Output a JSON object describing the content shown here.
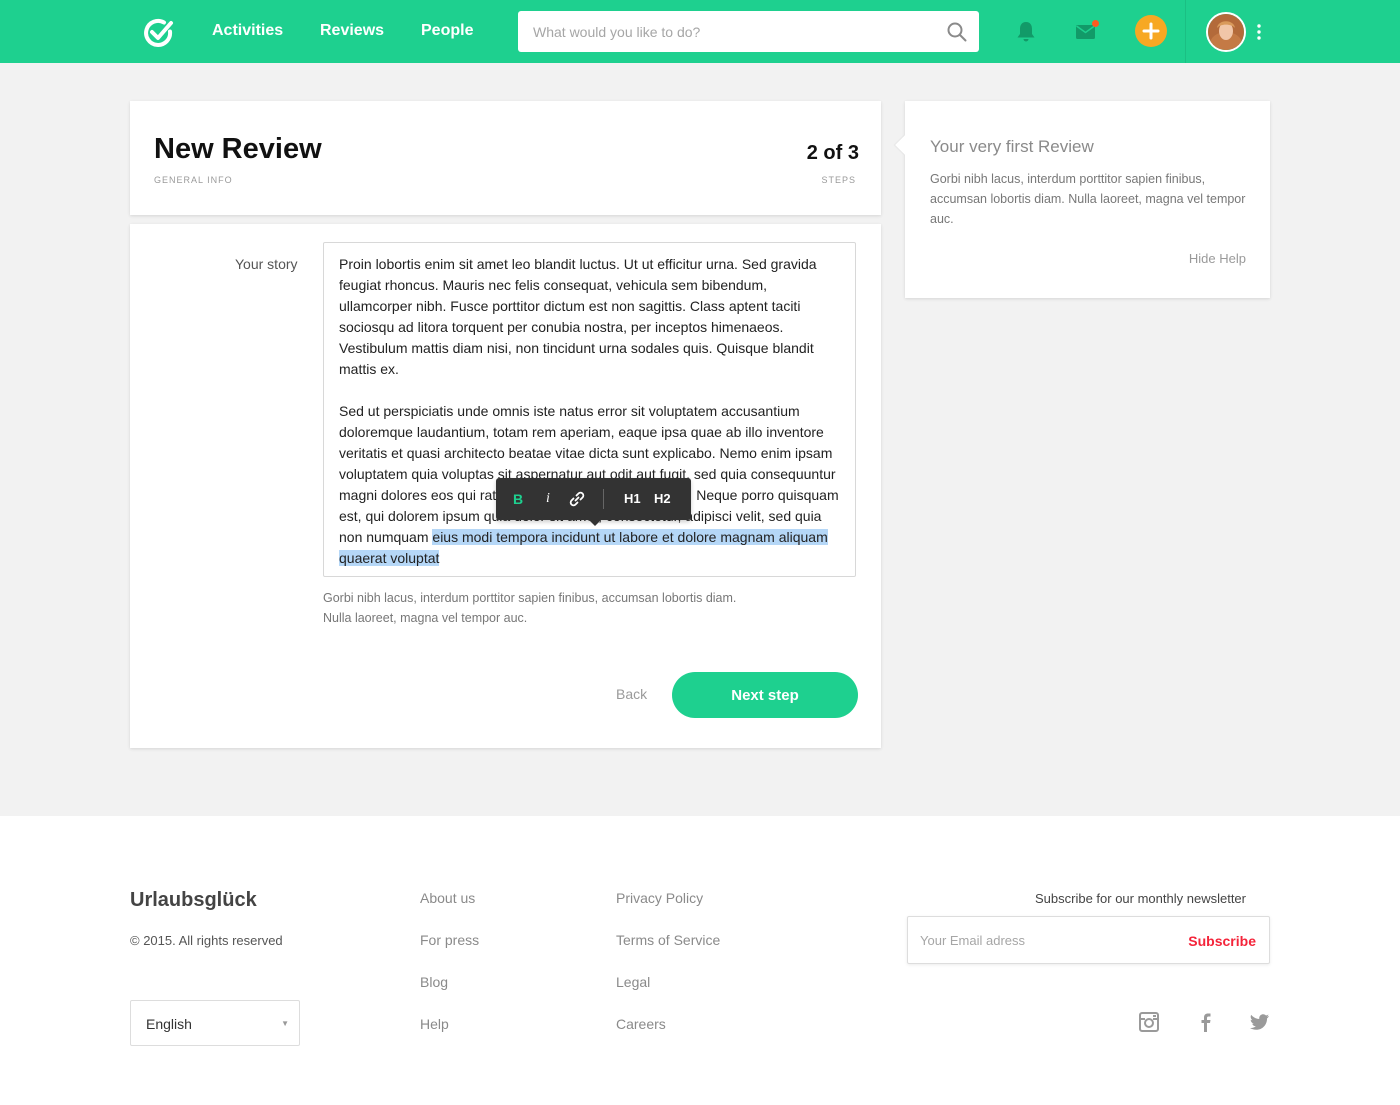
{
  "header": {
    "nav": [
      "Activities",
      "Reviews",
      "People"
    ],
    "search_placeholder": "What would you like to do?",
    "colors": {
      "brand": "#1ed08f",
      "accent": "#f7a823",
      "notification": "#ff5a1f"
    }
  },
  "review": {
    "title": "New Review",
    "subtitle": "GENERAL INFO",
    "step_count": "2 of 3",
    "step_label": "STEPS"
  },
  "form": {
    "story_label": "Your story",
    "paragraph_1": "Proin lobortis enim sit amet leo blandit luctus. Ut ut efficitur urna. Sed gravida feugiat rhoncus. Mauris nec felis consequat, vehicula sem bibendum, ullamcorper nibh. Fusce porttitor dictum est non sagittis. Class aptent taciti sociosqu ad litora torquent per conubia nostra, per inceptos himenaeos. Vestibulum mattis diam nisi, non tincidunt urna sodales quis. Quisque blandit mattis ex.",
    "paragraph_2": "Sed ut perspiciatis unde omnis iste natus error sit voluptatem accusantium doloremque laudantium, totam rem aperiam, eaque ipsa quae ab illo inventore veritatis et quasi architecto beatae vitae dicta sunt explicabo. Nemo enim ipsam voluptatem quia voluptas sit aspernatur aut odit aut fugit, sed quia consequuntur magni dolores eos qui ratione voluptatem sequi nesciunt. Neque porro quisquam est, qui dolorem ipsum quia dolor sit amet, consectetur, adipisci velit, sed quia non numquam ",
    "selected_text": "eius modi tempora incidunt ut labore et dolore magnam aliquam quaerat voluptat",
    "toolbar": {
      "bold": "B",
      "italic": "i",
      "h1": "H1",
      "h2": "H2"
    },
    "hint_line_1": "Gorbi nibh lacus, interdum porttitor sapien finibus, accumsan lobortis diam.",
    "hint_line_2": "Nulla laoreet, magna vel tempor auc.",
    "back_label": "Back",
    "next_label": "Next step"
  },
  "help": {
    "title": "Your very first Review",
    "text": "Gorbi nibh lacus, interdum porttitor sapien finibus, accumsan lobortis diam. Nulla laoreet, magna vel tempor auc.",
    "hide_label": "Hide Help"
  },
  "footer": {
    "brand": "Urlaubsglück",
    "copyright": "© 2015. All rights reserved",
    "language": "English",
    "links_col1": [
      "About us",
      "For press",
      "Blog",
      "Help"
    ],
    "links_col2": [
      "Privacy Policy",
      "Terms of Service",
      "Legal",
      "Careers"
    ],
    "newsletter_label": "Subscribe for our monthly newsletter",
    "email_placeholder": "Your Email adress",
    "subscribe_label": "Subscribe",
    "social": [
      "instagram-icon",
      "facebook-icon",
      "twitter-icon"
    ]
  }
}
